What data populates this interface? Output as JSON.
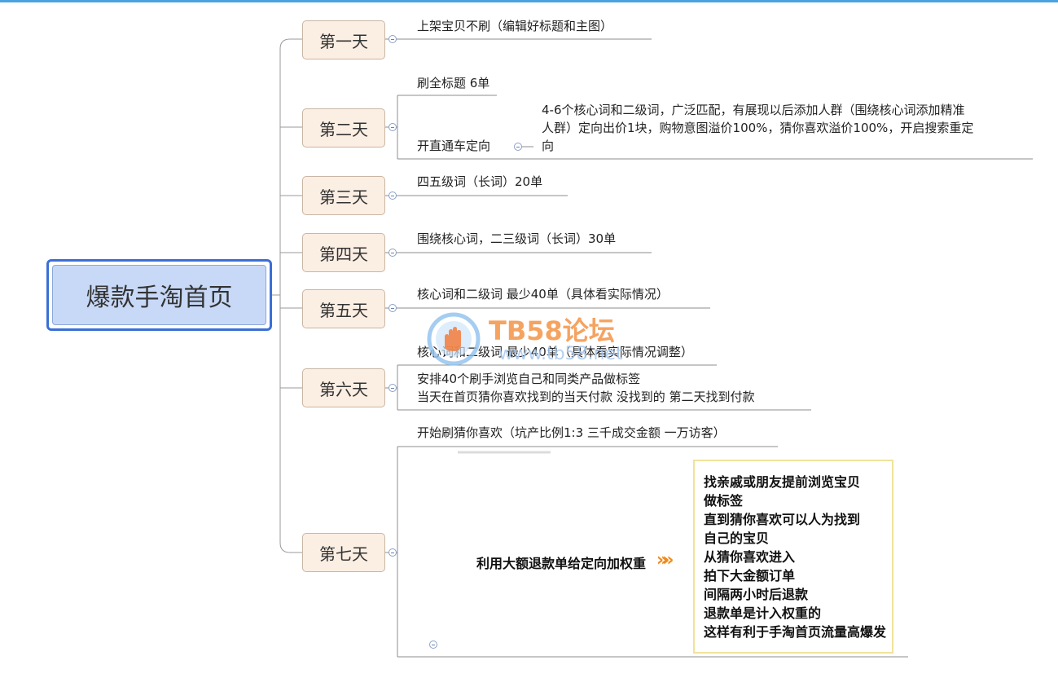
{
  "root": {
    "label": "爆款手淘首页"
  },
  "days": [
    {
      "label": "第一天",
      "items": [
        "上架宝贝不刷（编辑好标题和主图）"
      ]
    },
    {
      "label": "第二天",
      "items": [
        "刷全标题 6单",
        "开直通车定向"
      ],
      "sub": [
        "4-6个核心词和二级词，广泛匹配，有展现以后添加人群（围绕核心词添加精准",
        "人群）定向出价1块，购物意图溢价100%，猜你喜欢溢价100%，开启搜索重定",
        "向"
      ]
    },
    {
      "label": "第三天",
      "items": [
        "四五级词（长词）20单"
      ]
    },
    {
      "label": "第四天",
      "items": [
        "围绕核心词，二三级词（长词）30单"
      ]
    },
    {
      "label": "第五天",
      "items": [
        "核心词和二级词 最少40单（具体看实际情况）"
      ]
    },
    {
      "label": "第六天",
      "items": [
        "核心词和二级词 最少40单（具体看实际情况调整）",
        "安排40个刷手浏览自己和同类产品做标签",
        "当天在首页猜你喜欢找到的当天付款 没找到的 第二天找到付款"
      ]
    },
    {
      "label": "第七天",
      "items": [
        "开始刷猜你喜欢（坑产比例1:3 三千成交金额 一万访客）"
      ]
    }
  ],
  "image_note": {
    "strategy": "利用大额退款单给定向加权重",
    "arrow_glyph": "»»",
    "lines": [
      "找亲戚或朋友提前浏览宝贝",
      "做标签",
      "直到猜你喜欢可以人为找到",
      "自己的宝贝",
      "从猜你喜欢进入",
      "拍下大金额订单",
      "间隔两小时后退款",
      "退款单是计入权重的",
      "这样有利于手淘首页流量高爆发"
    ]
  },
  "watermark": {
    "title": "TB58论坛",
    "url": "www.tb58.net"
  },
  "colors": {
    "root_fill": "#c8d9f7",
    "root_border": "#3b6fd6",
    "day_fill": "#fbeee3",
    "accent_arrow": "#f08a1c",
    "watermark": "#f59a51"
  }
}
